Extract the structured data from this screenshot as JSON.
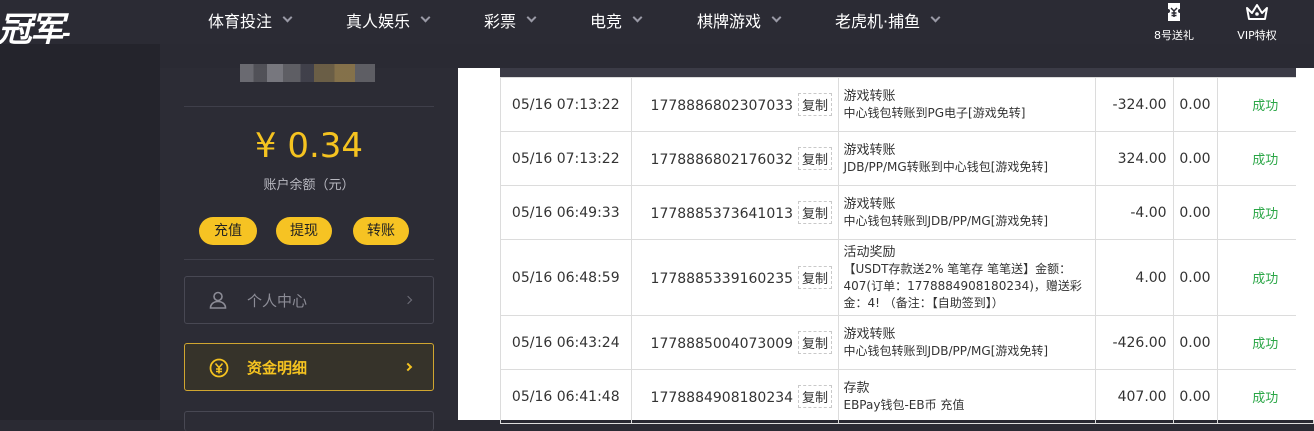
{
  "header": {
    "logo_text": "冠军",
    "nav": [
      {
        "label": "体育投注"
      },
      {
        "label": "真人娱乐"
      },
      {
        "label": "彩票"
      },
      {
        "label": "电竞"
      },
      {
        "label": "棋牌游戏"
      },
      {
        "label": "老虎机·捕鱼"
      }
    ],
    "promo_links": [
      {
        "label": "8号送礼",
        "icon": "ticket-icon"
      },
      {
        "label": "VIP特权",
        "icon": "crown-icon"
      }
    ]
  },
  "account": {
    "balance": "¥ 0.34",
    "balance_label": "账户余额（元）",
    "actions": [
      {
        "label": "充值"
      },
      {
        "label": "提现"
      },
      {
        "label": "转账"
      }
    ],
    "menu": [
      {
        "label": "个人中心",
        "icon": "user-icon",
        "active": false
      },
      {
        "label": "资金明细",
        "icon": "yuan-icon",
        "active": true
      }
    ]
  },
  "transactions": {
    "copy_label": "复制",
    "rows": [
      {
        "time": "05/16 07:13:22",
        "id": "1778886802307033",
        "type": "游戏转账",
        "detail": "中心钱包转账到PG电子[游戏免转]",
        "amount": "-324.00",
        "balance": "0.00",
        "status": "成功"
      },
      {
        "time": "05/16 07:13:22",
        "id": "1778886802176032",
        "type": "游戏转账",
        "detail": "JDB/PP/MG转账到中心钱包[游戏免转]",
        "amount": "324.00",
        "balance": "0.00",
        "status": "成功"
      },
      {
        "time": "05/16 06:49:33",
        "id": "1778885373641013",
        "type": "游戏转账",
        "detail": "中心钱包转账到JDB/PP/MG[游戏免转]",
        "amount": "-4.00",
        "balance": "0.00",
        "status": "成功"
      },
      {
        "time": "05/16 06:48:59",
        "id": "1778885339160235",
        "type": "活动奖励",
        "detail": "【USDT存款送2% 笔笔存 笔笔送】金额：407(订单：1778884908180234)，赠送彩金：4! （备注：【自助签到】）",
        "amount": "4.00",
        "balance": "0.00",
        "status": "成功"
      },
      {
        "time": "05/16 06:43:24",
        "id": "1778885004073009",
        "type": "游戏转账",
        "detail": "中心钱包转账到JDB/PP/MG[游戏免转]",
        "amount": "-426.00",
        "balance": "0.00",
        "status": "成功"
      },
      {
        "time": "05/16 06:41:48",
        "id": "1778884908180234",
        "type": "存款",
        "detail": "EBPay钱包-EB币 充值",
        "amount": "407.00",
        "balance": "0.00",
        "status": "成功"
      }
    ]
  },
  "colors": {
    "accent": "#f6c323",
    "success": "#2aa646",
    "topbar": "#2b2b34"
  }
}
